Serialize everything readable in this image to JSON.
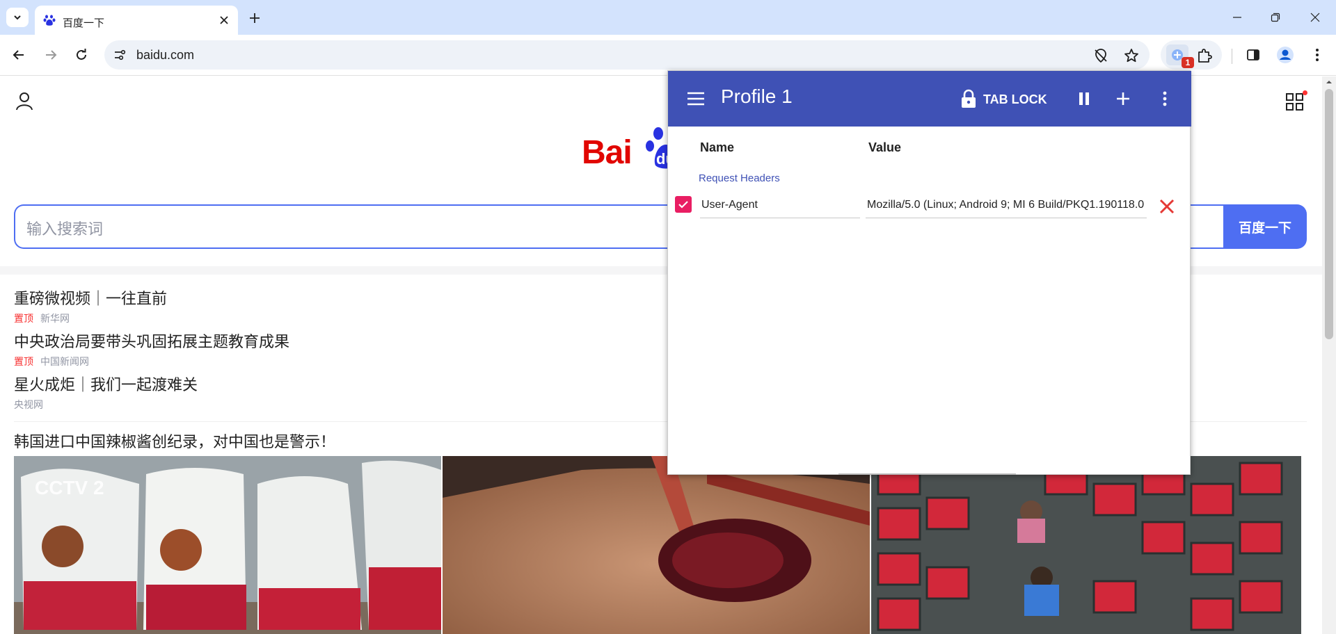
{
  "browser": {
    "tab_title": "百度一下",
    "url": "baidu.com",
    "extension_badge": "1"
  },
  "page": {
    "logo_text": "Bai",
    "search_placeholder": "输入搜索词",
    "search_button": "百度一下",
    "news": [
      {
        "title": "重磅微视频｜一往直前",
        "pin": "置顶",
        "source": "新华网"
      },
      {
        "title": "中央政治局要带头巩固拓展主题教育成果",
        "pin": "置顶",
        "source": "中国新闻网"
      },
      {
        "title": "星火成炬｜我们一起渡难关",
        "pin": "",
        "source": "央视网"
      }
    ],
    "video_title": "韩国进口中国辣椒酱创纪录，对中国也是警示！"
  },
  "popup": {
    "profile_title": "Profile 1",
    "tab_lock_label": "TAB LOCK",
    "col_name": "Name",
    "col_value": "Value",
    "section_label": "Request Headers",
    "header_row": {
      "enabled": true,
      "name": "User-Agent",
      "value": "Mozilla/5.0 (Linux; Android 9; MI 6 Build/PKQ1.190118.0"
    },
    "accent_color": "#3f51b5",
    "checkbox_color": "#e91e63",
    "delete_color": "#e53935"
  },
  "colors": {
    "tabstrip": "#d3e3fd",
    "baidu_blue": "#4e6ef2",
    "baidu_red": "#e10601",
    "pin_red": "#f73131"
  }
}
